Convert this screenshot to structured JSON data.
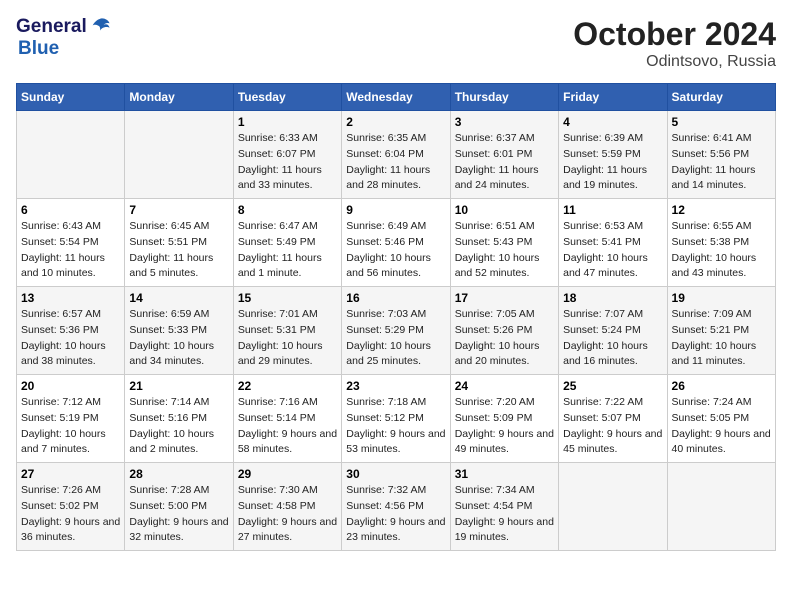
{
  "header": {
    "logo_general": "General",
    "logo_blue": "Blue",
    "month_title": "October 2024",
    "location": "Odintsovo, Russia"
  },
  "weekdays": [
    "Sunday",
    "Monday",
    "Tuesday",
    "Wednesday",
    "Thursday",
    "Friday",
    "Saturday"
  ],
  "weeks": [
    [
      {
        "day": "",
        "sunrise": "",
        "sunset": "",
        "daylight": ""
      },
      {
        "day": "",
        "sunrise": "",
        "sunset": "",
        "daylight": ""
      },
      {
        "day": "1",
        "sunrise": "Sunrise: 6:33 AM",
        "sunset": "Sunset: 6:07 PM",
        "daylight": "Daylight: 11 hours and 33 minutes."
      },
      {
        "day": "2",
        "sunrise": "Sunrise: 6:35 AM",
        "sunset": "Sunset: 6:04 PM",
        "daylight": "Daylight: 11 hours and 28 minutes."
      },
      {
        "day": "3",
        "sunrise": "Sunrise: 6:37 AM",
        "sunset": "Sunset: 6:01 PM",
        "daylight": "Daylight: 11 hours and 24 minutes."
      },
      {
        "day": "4",
        "sunrise": "Sunrise: 6:39 AM",
        "sunset": "Sunset: 5:59 PM",
        "daylight": "Daylight: 11 hours and 19 minutes."
      },
      {
        "day": "5",
        "sunrise": "Sunrise: 6:41 AM",
        "sunset": "Sunset: 5:56 PM",
        "daylight": "Daylight: 11 hours and 14 minutes."
      }
    ],
    [
      {
        "day": "6",
        "sunrise": "Sunrise: 6:43 AM",
        "sunset": "Sunset: 5:54 PM",
        "daylight": "Daylight: 11 hours and 10 minutes."
      },
      {
        "day": "7",
        "sunrise": "Sunrise: 6:45 AM",
        "sunset": "Sunset: 5:51 PM",
        "daylight": "Daylight: 11 hours and 5 minutes."
      },
      {
        "day": "8",
        "sunrise": "Sunrise: 6:47 AM",
        "sunset": "Sunset: 5:49 PM",
        "daylight": "Daylight: 11 hours and 1 minute."
      },
      {
        "day": "9",
        "sunrise": "Sunrise: 6:49 AM",
        "sunset": "Sunset: 5:46 PM",
        "daylight": "Daylight: 10 hours and 56 minutes."
      },
      {
        "day": "10",
        "sunrise": "Sunrise: 6:51 AM",
        "sunset": "Sunset: 5:43 PM",
        "daylight": "Daylight: 10 hours and 52 minutes."
      },
      {
        "day": "11",
        "sunrise": "Sunrise: 6:53 AM",
        "sunset": "Sunset: 5:41 PM",
        "daylight": "Daylight: 10 hours and 47 minutes."
      },
      {
        "day": "12",
        "sunrise": "Sunrise: 6:55 AM",
        "sunset": "Sunset: 5:38 PM",
        "daylight": "Daylight: 10 hours and 43 minutes."
      }
    ],
    [
      {
        "day": "13",
        "sunrise": "Sunrise: 6:57 AM",
        "sunset": "Sunset: 5:36 PM",
        "daylight": "Daylight: 10 hours and 38 minutes."
      },
      {
        "day": "14",
        "sunrise": "Sunrise: 6:59 AM",
        "sunset": "Sunset: 5:33 PM",
        "daylight": "Daylight: 10 hours and 34 minutes."
      },
      {
        "day": "15",
        "sunrise": "Sunrise: 7:01 AM",
        "sunset": "Sunset: 5:31 PM",
        "daylight": "Daylight: 10 hours and 29 minutes."
      },
      {
        "day": "16",
        "sunrise": "Sunrise: 7:03 AM",
        "sunset": "Sunset: 5:29 PM",
        "daylight": "Daylight: 10 hours and 25 minutes."
      },
      {
        "day": "17",
        "sunrise": "Sunrise: 7:05 AM",
        "sunset": "Sunset: 5:26 PM",
        "daylight": "Daylight: 10 hours and 20 minutes."
      },
      {
        "day": "18",
        "sunrise": "Sunrise: 7:07 AM",
        "sunset": "Sunset: 5:24 PM",
        "daylight": "Daylight: 10 hours and 16 minutes."
      },
      {
        "day": "19",
        "sunrise": "Sunrise: 7:09 AM",
        "sunset": "Sunset: 5:21 PM",
        "daylight": "Daylight: 10 hours and 11 minutes."
      }
    ],
    [
      {
        "day": "20",
        "sunrise": "Sunrise: 7:12 AM",
        "sunset": "Sunset: 5:19 PM",
        "daylight": "Daylight: 10 hours and 7 minutes."
      },
      {
        "day": "21",
        "sunrise": "Sunrise: 7:14 AM",
        "sunset": "Sunset: 5:16 PM",
        "daylight": "Daylight: 10 hours and 2 minutes."
      },
      {
        "day": "22",
        "sunrise": "Sunrise: 7:16 AM",
        "sunset": "Sunset: 5:14 PM",
        "daylight": "Daylight: 9 hours and 58 minutes."
      },
      {
        "day": "23",
        "sunrise": "Sunrise: 7:18 AM",
        "sunset": "Sunset: 5:12 PM",
        "daylight": "Daylight: 9 hours and 53 minutes."
      },
      {
        "day": "24",
        "sunrise": "Sunrise: 7:20 AM",
        "sunset": "Sunset: 5:09 PM",
        "daylight": "Daylight: 9 hours and 49 minutes."
      },
      {
        "day": "25",
        "sunrise": "Sunrise: 7:22 AM",
        "sunset": "Sunset: 5:07 PM",
        "daylight": "Daylight: 9 hours and 45 minutes."
      },
      {
        "day": "26",
        "sunrise": "Sunrise: 7:24 AM",
        "sunset": "Sunset: 5:05 PM",
        "daylight": "Daylight: 9 hours and 40 minutes."
      }
    ],
    [
      {
        "day": "27",
        "sunrise": "Sunrise: 7:26 AM",
        "sunset": "Sunset: 5:02 PM",
        "daylight": "Daylight: 9 hours and 36 minutes."
      },
      {
        "day": "28",
        "sunrise": "Sunrise: 7:28 AM",
        "sunset": "Sunset: 5:00 PM",
        "daylight": "Daylight: 9 hours and 32 minutes."
      },
      {
        "day": "29",
        "sunrise": "Sunrise: 7:30 AM",
        "sunset": "Sunset: 4:58 PM",
        "daylight": "Daylight: 9 hours and 27 minutes."
      },
      {
        "day": "30",
        "sunrise": "Sunrise: 7:32 AM",
        "sunset": "Sunset: 4:56 PM",
        "daylight": "Daylight: 9 hours and 23 minutes."
      },
      {
        "day": "31",
        "sunrise": "Sunrise: 7:34 AM",
        "sunset": "Sunset: 4:54 PM",
        "daylight": "Daylight: 9 hours and 19 minutes."
      },
      {
        "day": "",
        "sunrise": "",
        "sunset": "",
        "daylight": ""
      },
      {
        "day": "",
        "sunrise": "",
        "sunset": "",
        "daylight": ""
      }
    ]
  ]
}
